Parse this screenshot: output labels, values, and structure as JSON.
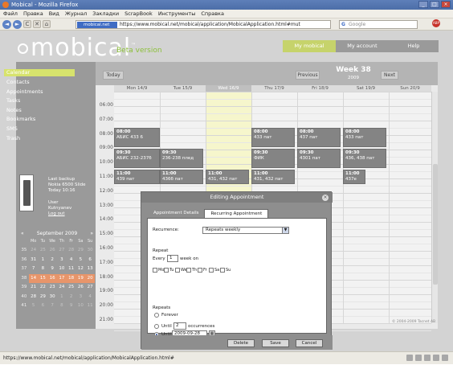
{
  "window": {
    "title": "Mobical - Mozilla Firefox",
    "btn_min": "_",
    "btn_max": "□",
    "btn_close": "×"
  },
  "menu": [
    "Файл",
    "Правка",
    "Вид",
    "Журнал",
    "Закладки",
    "ScrapBook",
    "Инструменты",
    "Справка"
  ],
  "nav": {
    "back": "◄",
    "forward": "►",
    "reload": "C",
    "stop": "✕",
    "home": "⌂",
    "domain": "mobical.net",
    "url": "https://www.mobical.net/mobical/application/MobicalApplication.html#mut",
    "search_placeholder": "Google",
    "search_logo": "G"
  },
  "app": {
    "logo": "mobical",
    "superscript": "™",
    "beta": "Beta version",
    "topnav": [
      {
        "label": "My mobical",
        "active": true
      },
      {
        "label": "My account",
        "active": false
      },
      {
        "label": "Help",
        "active": false
      }
    ],
    "sidebar": [
      "Calendar",
      "Contacts",
      "Appointments",
      "Tasks",
      "Notes",
      "Bookmarks",
      "SMS",
      "Trash"
    ],
    "backup": {
      "line1": "Last backup",
      "line2": "Nokia 6500 Slide",
      "line3": "Today 10:16",
      "line4": "User",
      "line5": "Kutnyanev",
      "logout": "Log out"
    },
    "minical": {
      "prev": "«",
      "next": "»",
      "month": "September 2009",
      "headers": [
        "",
        "Mo",
        "Tu",
        "We",
        "Th",
        "Fr",
        "Sa",
        "Su"
      ],
      "rows": [
        [
          "35",
          "24",
          "25",
          "26",
          "27",
          "28",
          "29",
          "30"
        ],
        [
          "36",
          "31",
          "1",
          "2",
          "3",
          "4",
          "5",
          "6"
        ],
        [
          "37",
          "7",
          "8",
          "9",
          "10",
          "11",
          "12",
          "13"
        ],
        [
          "38",
          "14",
          "15",
          "16",
          "17",
          "18",
          "19",
          "20"
        ],
        [
          "39",
          "21",
          "22",
          "23",
          "24",
          "25",
          "26",
          "27"
        ],
        [
          "40",
          "28",
          "29",
          "30",
          "1",
          "2",
          "3",
          "4"
        ],
        [
          "41",
          "5",
          "6",
          "7",
          "8",
          "9",
          "10",
          "11"
        ]
      ]
    },
    "calendar": {
      "today_btn": "Today",
      "prev_btn": "Previous",
      "next_btn": "Next",
      "week": "Week 38",
      "year": "2009",
      "days": [
        "Mon 14/9",
        "Tue 15/9",
        "Wed 16/9",
        "Thu 17/9",
        "Fri 18/9",
        "Sat 19/9",
        "Sun 20/9"
      ],
      "hours": [
        "06:00",
        "07:00",
        "08:00",
        "09:00",
        "10:00",
        "11:00",
        "12:00",
        "13:00",
        "14:00",
        "15:00",
        "16:00",
        "17:00",
        "18:00",
        "19:00",
        "20:00",
        "21:00"
      ],
      "appointments": [
        {
          "time": "08:00",
          "text": "АБИС 433 6"
        },
        {
          "time": "08:00",
          "text": "433 пат"
        },
        {
          "time": "08:00",
          "text": "437 пат"
        },
        {
          "time": "08:00",
          "text": "433 пат"
        },
        {
          "time": "09:30",
          "text": "АБИС 232-237б"
        },
        {
          "time": "09:30",
          "text": "236-238 плед"
        },
        {
          "time": "09:30",
          "text": "ФИК"
        },
        {
          "time": "09:30",
          "text": "4301 пат"
        },
        {
          "time": "09:30",
          "text": "436, 438 пат"
        },
        {
          "time": "11:00",
          "text": "439 пат"
        },
        {
          "time": "11:00",
          "text": "436б пат"
        },
        {
          "time": "11:00",
          "text": "431, 432 пат"
        },
        {
          "time": "11:00",
          "text": "431, 432 пат"
        },
        {
          "time": "11:00",
          "text": "437e"
        }
      ]
    },
    "copyright": "© 2004-2009 Tacnet AB"
  },
  "dialog": {
    "title": "Editing Appointment",
    "close": "×",
    "tabs": [
      {
        "label": "Appointment Details",
        "active": false
      },
      {
        "label": "Recurring Appointment",
        "active": true
      }
    ],
    "recurrence_label": "Recurrence:",
    "recurrence_value": "Repeats weekly",
    "repeat_label": "Repeat",
    "every_label": "Every",
    "every_value": "1",
    "week_on": "week on",
    "weekdays": [
      "Mo",
      "Tu",
      "We",
      "Th",
      "Fr",
      "Sa",
      "Su"
    ],
    "repeats_label": "Repeats",
    "forever": "Forever",
    "until_label": "Until",
    "until_count": "2",
    "occurrences": "occurrences",
    "until_date_label": "Until",
    "until_date": "2009-09-28",
    "buttons": {
      "delete": "Delete",
      "save": "Save",
      "cancel": "Cancel"
    }
  },
  "statusbar": "https://www.mobical.net/mobical/application/MobicalApplication.html#"
}
